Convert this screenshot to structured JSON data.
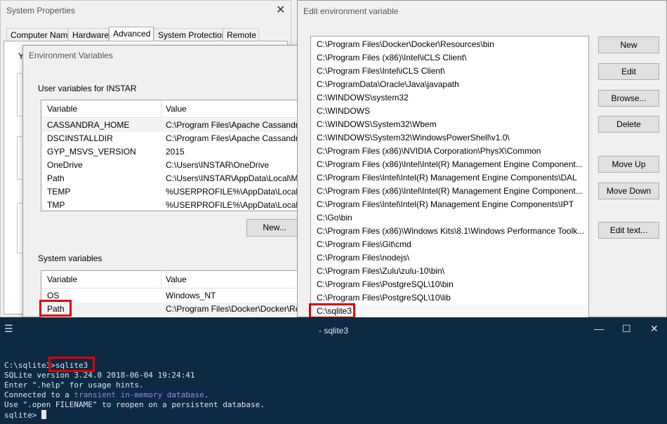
{
  "system_properties": {
    "title": "System Properties",
    "tabs": [
      "Computer Name",
      "Hardware",
      "Advanced",
      "System Protection",
      "Remote"
    ],
    "active_tab": "Advanced",
    "partial_text": "Y"
  },
  "env_vars": {
    "title": "Environment Variables",
    "user_group_label": "User variables for INSTAR",
    "columns": [
      "Variable",
      "Value"
    ],
    "user_vars": [
      {
        "variable": "CASSANDRA_HOME",
        "value": "C:\\Program Files\\Apache Cassandra"
      },
      {
        "variable": "DSCINSTALLDIR",
        "value": "C:\\Program Files\\Apache Cassandra"
      },
      {
        "variable": "GYP_MSVS_VERSION",
        "value": "2015"
      },
      {
        "variable": "OneDrive",
        "value": "C:\\Users\\INSTAR\\OneDrive"
      },
      {
        "variable": "Path",
        "value": "C:\\Users\\INSTAR\\AppData\\Local\\M"
      },
      {
        "variable": "TEMP",
        "value": "%USERPROFILE%\\AppData\\Local\\T"
      },
      {
        "variable": "TMP",
        "value": "%USERPROFILE%\\AppData\\Local\\T"
      }
    ],
    "new_button": "New...",
    "system_group_label": "System variables",
    "system_vars": [
      {
        "variable": "OS",
        "value": "Windows_NT"
      },
      {
        "variable": "Path",
        "value": "C:\\Program Files\\Docker\\Docker\\Re"
      }
    ]
  },
  "edit_env": {
    "title": "Edit environment variable",
    "paths": [
      "C:\\Program Files\\Docker\\Docker\\Resources\\bin",
      "C:\\Program Files (x86)\\Intel\\iCLS Client\\",
      "C:\\Program Files\\Intel\\iCLS Client\\",
      "C:\\ProgramData\\Oracle\\Java\\javapath",
      "C:\\WINDOWS\\system32",
      "C:\\WINDOWS",
      "C:\\WINDOWS\\System32\\Wbem",
      "C:\\WINDOWS\\System32\\WindowsPowerShell\\v1.0\\",
      "C:\\Program Files (x86)\\NVIDIA Corporation\\PhysX\\Common",
      "C:\\Program Files (x86)\\Intel\\Intel(R) Management Engine Component...",
      "C:\\Program Files\\Intel\\Intel(R) Management Engine Components\\DAL",
      "C:\\Program Files (x86)\\Intel\\Intel(R) Management Engine Component...",
      "C:\\Program Files\\Intel\\Intel(R) Management Engine Components\\IPT",
      "C:\\Go\\bin",
      "C:\\Program Files (x86)\\Windows Kits\\8.1\\Windows Performance Toolk...",
      "C:\\Program Files\\Git\\cmd",
      "C:\\Program Files\\nodejs\\",
      "C:\\Program Files\\Zulu\\zulu-10\\bin\\",
      "C:\\Program Files\\PostgreSQL\\10\\bin",
      "C:\\Program Files\\PostgreSQL\\10\\lib",
      "C:\\sqlite3"
    ],
    "buttons": {
      "new": "New",
      "edit": "Edit",
      "browse": "Browse...",
      "delete": "Delete",
      "move_up": "Move Up",
      "move_down": "Move Down",
      "edit_text": "Edit text..."
    }
  },
  "terminal": {
    "title": "- sqlite3",
    "prompt": "C:\\sqlite3>",
    "command": "sqlite3",
    "lines": {
      "version": "SQLite version 3.24.0 2018-06-04 19:24:41",
      "help": "Enter \".help\" for usage hints.",
      "connected_a": "Connected to a ",
      "connected_b": "transient in-memory database",
      "connected_c": ".",
      "reopen": "Use \".open FILENAME\" to reopen on a persistent database."
    },
    "sqlite_prompt": "sqlite> "
  },
  "colors": {
    "highlight_box": "#e00000",
    "terminal_bg": "#0c2a43",
    "terminal_accent": "#9a86e8"
  }
}
